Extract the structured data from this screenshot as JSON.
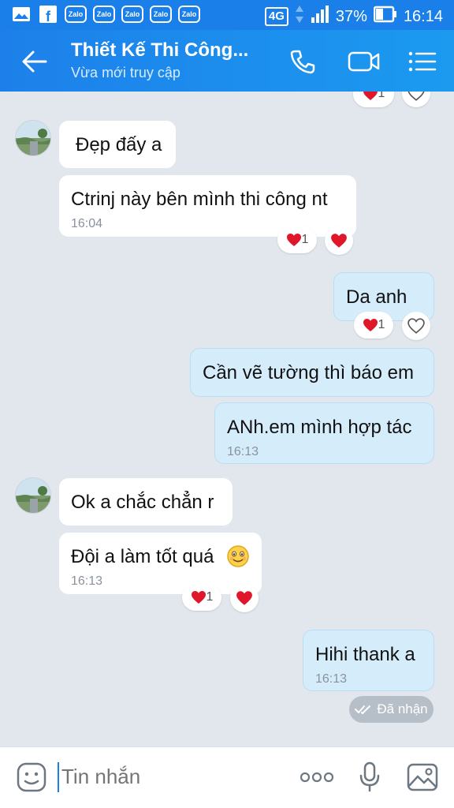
{
  "status_bar": {
    "network": "4G",
    "battery": "37%",
    "time": "16:14",
    "notif_icons": [
      "gallery-icon",
      "facebook-icon",
      "zalo-icon",
      "zalo-icon",
      "zalo-icon",
      "zalo-icon",
      "zalo-icon"
    ],
    "zalo_label": "Zalo",
    "facebook_label": "f"
  },
  "header": {
    "title": "Thiết Kế Thi Công...",
    "subtitle": "Vừa mới truy cập",
    "accent": "#1a7fe8"
  },
  "top_reaction_count": "1",
  "messages": [
    {
      "dir": "in",
      "text": "Đẹp đấy a"
    },
    {
      "dir": "in",
      "text": "Ctrinj này bên mình thi công nt",
      "time": "16:04",
      "reaction_count": "1"
    },
    {
      "dir": "out",
      "text": "Da anh",
      "reaction_count": "1"
    },
    {
      "dir": "out",
      "text": "Cần vẽ tường thì báo em"
    },
    {
      "dir": "out",
      "text": "ANh.em mình hợp tác",
      "time": "16:13"
    },
    {
      "dir": "in",
      "text": "Ok a chắc chẳn r"
    },
    {
      "dir": "in",
      "text": "Đội a làm tốt quá",
      "time": "16:13",
      "reaction_count": "1"
    },
    {
      "dir": "out",
      "text": "Hihi thank a",
      "time": "16:13"
    }
  ],
  "received_label": "Đã nhận",
  "input": {
    "placeholder": "Tin nhắn"
  },
  "colors": {
    "heart": "#e0162b",
    "incoming_bubble": "#ffffff",
    "outgoing_bubble": "#d5ecfb",
    "background": "#e2e7ee"
  }
}
